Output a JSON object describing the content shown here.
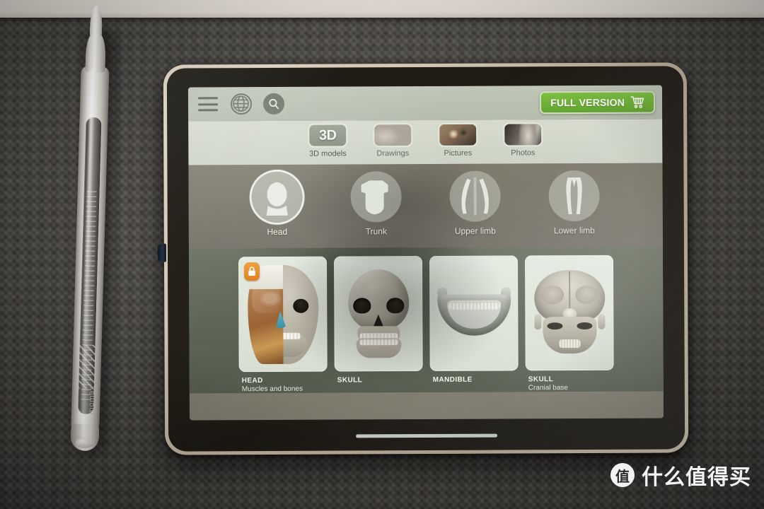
{
  "scene": {
    "description": "Tablet on a dark woven desk mat with a silver stylus beside it",
    "stylus_brand": "momax",
    "background_color": "#464440",
    "top_surface_color": "#e7e1d8"
  },
  "app": {
    "appbar": {
      "menu_icon": "hamburger-menu-icon",
      "globe_icon": "globe-icon",
      "search_icon": "search-icon",
      "full_version_label": "FULL VERSION",
      "cart_icon": "shopping-cart-icon",
      "accent_color": "#69ad30"
    },
    "media_tabs": [
      {
        "label": "3D models",
        "badge": "3D",
        "icon": "cube-3d-icon",
        "active": true
      },
      {
        "label": "Drawings",
        "badge": "",
        "icon": "drawing-thumbnail",
        "active": false
      },
      {
        "label": "Pictures",
        "badge": "",
        "icon": "picture-thumbnail",
        "active": false
      },
      {
        "label": "Photos",
        "badge": "",
        "icon": "photo-thumbnail",
        "active": false
      }
    ],
    "regions": [
      {
        "label": "Head",
        "icon": "head-silhouette-icon",
        "selected": true
      },
      {
        "label": "Trunk",
        "icon": "trunk-silhouette-icon",
        "selected": false
      },
      {
        "label": "Upper limb",
        "icon": "upper-limb-silhouette-icon",
        "selected": false
      },
      {
        "label": "Lower limb",
        "icon": "lower-limb-silhouette-icon",
        "selected": false
      }
    ],
    "cards": [
      {
        "title": "HEAD",
        "subtitle": "Muscles and bones",
        "locked": true,
        "lock_icon": "padlock-icon",
        "art": "head-muscles-bones"
      },
      {
        "title": "SKULL",
        "subtitle": "",
        "locked": false,
        "lock_icon": "",
        "art": "skull-front"
      },
      {
        "title": "MANDIBLE",
        "subtitle": "",
        "locked": false,
        "lock_icon": "",
        "art": "mandible"
      },
      {
        "title": "SKULL",
        "subtitle": "Cranial base",
        "locked": false,
        "lock_icon": "",
        "art": "skull-cranial-base"
      }
    ],
    "home_indicator": "home-indicator-bar"
  },
  "watermark": {
    "badge": "值",
    "text": "什么值得买"
  }
}
